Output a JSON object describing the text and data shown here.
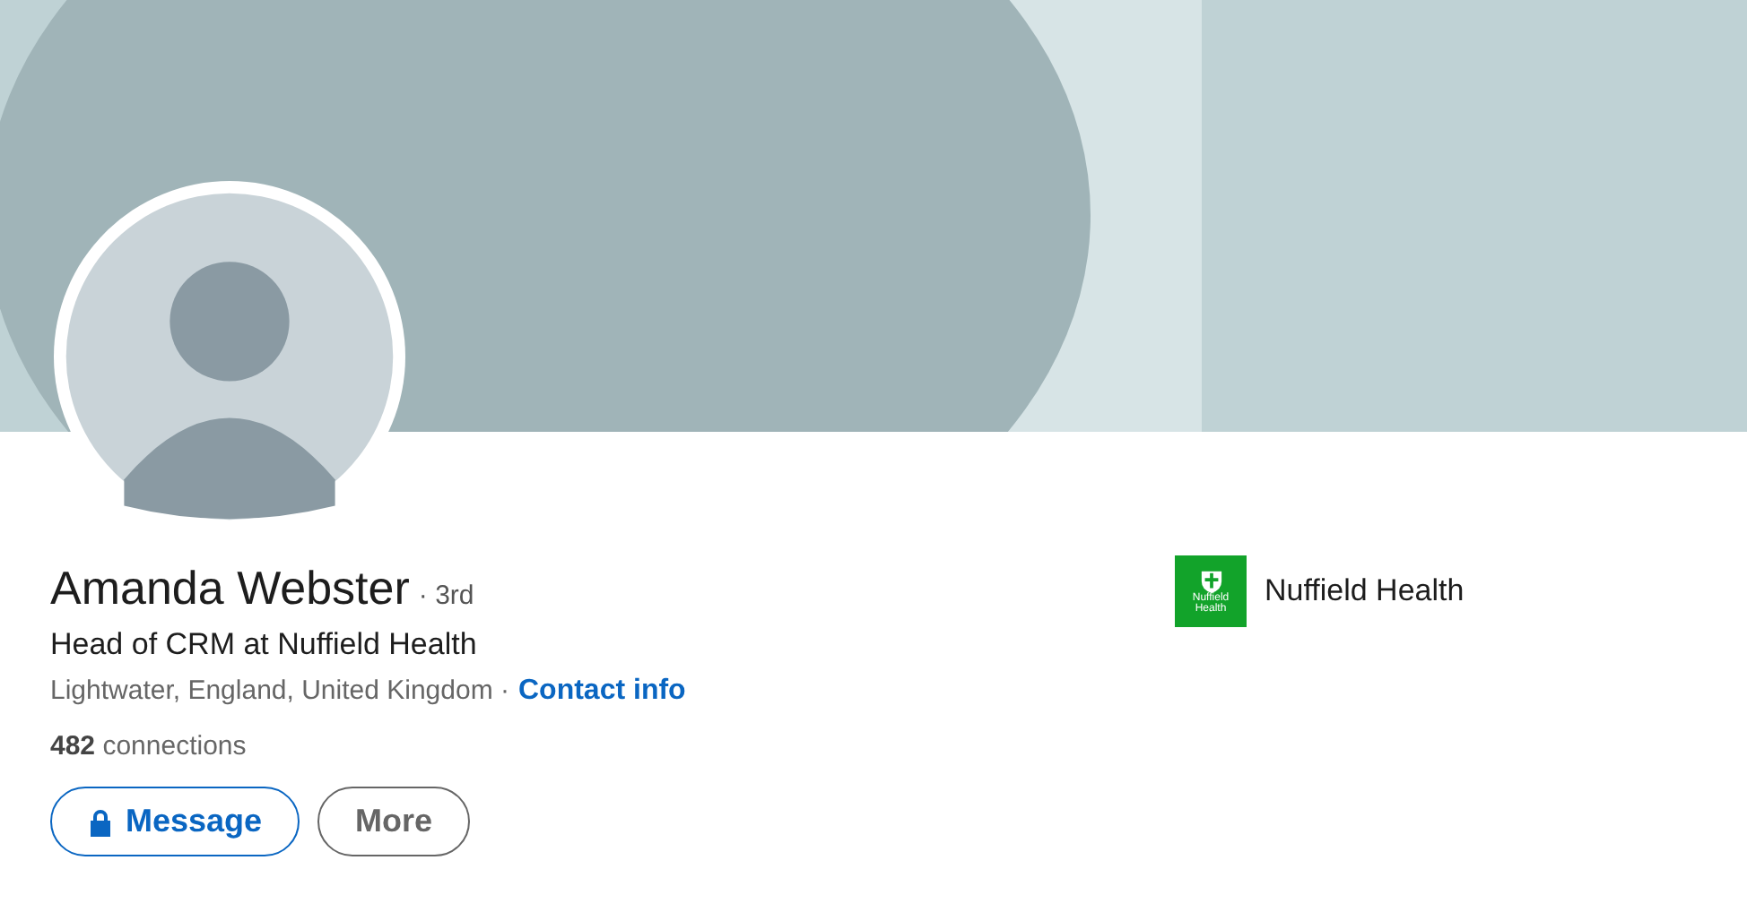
{
  "profile": {
    "name": "Amanda Webster",
    "degree": "· 3rd",
    "headline": "Head of CRM at Nuffield Health",
    "location": "Lightwater, England, United Kingdom ·",
    "contact_link": "Contact info",
    "connections": "**482** connections"
  },
  "actions": [
    {
      "label": "Message",
      "kind": "primary"
    },
    {
      "label": "More",
      "kind": "secondary"
    }
  ],
  "company": {
    "logo_text": "Nuffield Health",
    "name": "Nuffield Health"
  }
}
